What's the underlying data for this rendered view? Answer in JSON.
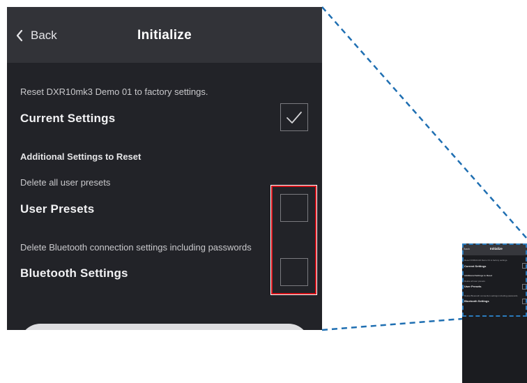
{
  "header": {
    "back_label": "Back",
    "title": "Initialize"
  },
  "intro": {
    "description": "Reset DXR10mk3 Demo 01 to factory settings."
  },
  "settings": [
    {
      "id": "current",
      "label": "Current Settings",
      "description": "",
      "checked": true
    },
    {
      "id": "user_presets",
      "label": "User Presets",
      "description": "Delete all user presets",
      "checked": false
    },
    {
      "id": "bluetooth",
      "label": "Bluetooth Settings",
      "description": "Delete Bluetooth connection settings including passwords",
      "checked": false
    }
  ],
  "additional_section_title": "Additional Settings to Reset",
  "icons": {
    "back": "chevron-left-icon",
    "check": "checkmark-icon"
  },
  "colors": {
    "panel_background": "#222328",
    "header_background": "#323338",
    "highlight_border": "#d9141b",
    "callout_line": "#1f6fb2"
  },
  "thumbnail": {
    "back_label": "Back",
    "title": "Initialize",
    "description": "Reset DXR10mk3 Demo 01 to factory settings.",
    "current_label": "Current Settings",
    "section_title": "Additional Settings to Reset",
    "user_presets_description": "Delete all user presets",
    "user_presets_label": "User Presets",
    "bluetooth_description": "Delete Bluetooth connection settings including passwords",
    "bluetooth_label": "Bluetooth Settings"
  }
}
